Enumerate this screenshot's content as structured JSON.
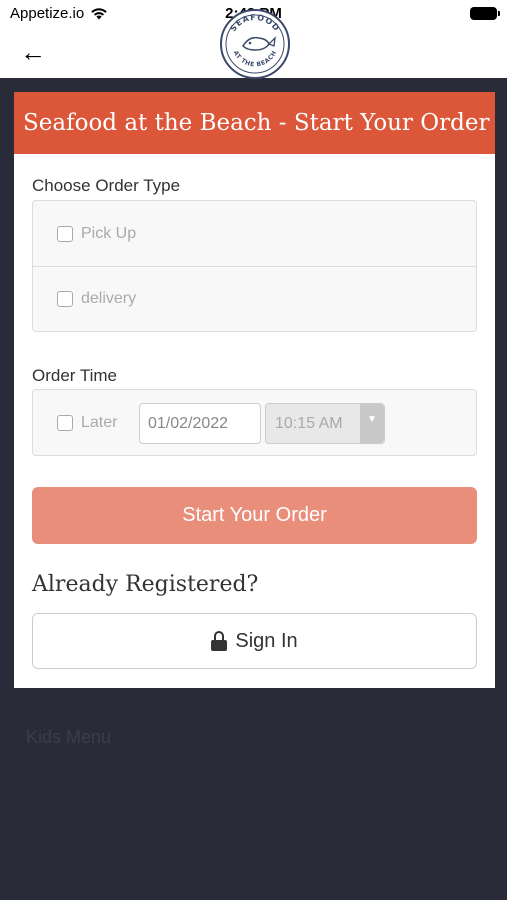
{
  "status_bar": {
    "carrier": "Appetize.io",
    "time": "2:42 PM"
  },
  "nav": {
    "back_icon": "←",
    "logo_top_text": "SEAFOOD",
    "logo_bottom_text": "AT THE BEACH"
  },
  "card": {
    "title": "Seafood at the Beach - Start Your Order",
    "order_type": {
      "label": "Choose Order Type",
      "options": [
        "Pick Up",
        "delivery"
      ]
    },
    "order_time": {
      "label": "Order Time",
      "later_label": "Later",
      "date_value": "01/02/2022",
      "time_value": "10:15 AM"
    },
    "start_button": "Start Your Order",
    "registered_heading": "Already Registered?",
    "sign_in_button": "Sign In"
  },
  "background_menu": {
    "item": "Kids Menu"
  },
  "colors": {
    "header": "#dc5639",
    "start_button": "#e88e7b",
    "background": "#2a2b38"
  }
}
